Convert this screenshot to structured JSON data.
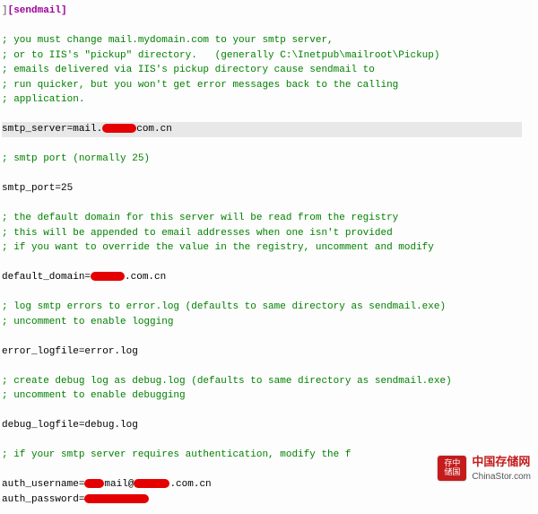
{
  "section": "[sendmail]",
  "comments": {
    "c1": "; you must change mail.mydomain.com to your smtp server,",
    "c2": "; or to IIS's \"pickup\" directory.   (generally C:\\Inetpub\\mailroot\\Pickup)",
    "c3": "; emails delivered via IIS's pickup directory cause sendmail to",
    "c4": "; run quicker, but you won't get error messages back to the calling",
    "c5": "; application.",
    "c6": "; smtp port (normally 25)",
    "c7": "; the default domain for this server will be read from the registry",
    "c8": "; this will be appended to email addresses when one isn't provided",
    "c9": "; if you want to override the value in the registry, uncomment and modify",
    "c10": "; log smtp errors to error.log (defaults to same directory as sendmail.exe)",
    "c11": "; uncomment to enable logging",
    "c12": "; create debug log as debug.log (defaults to same directory as sendmail.exe)",
    "c13": "; uncomment to enable debugging",
    "c14": "; if your smtp server requires authentication, modify the f"
  },
  "kv": {
    "smtp_server_key": "smtp_server=mail.",
    "smtp_server_suffix": "com.cn",
    "smtp_port": "smtp_port=25",
    "default_domain_key": "default_domain=",
    "default_domain_suffix": ".com.cn",
    "error_logfile": "error_logfile=error.log",
    "debug_logfile": "debug_logfile=debug.log",
    "auth_username_key": "auth_username=",
    "auth_username_mid": "mail@",
    "auth_username_suffix": ".com.cn",
    "auth_password_key": "auth_password="
  },
  "watermark": {
    "badge_top": "存中",
    "badge_bot": "储国",
    "cn": "中国存储网",
    "en": "ChinaStor.com"
  }
}
